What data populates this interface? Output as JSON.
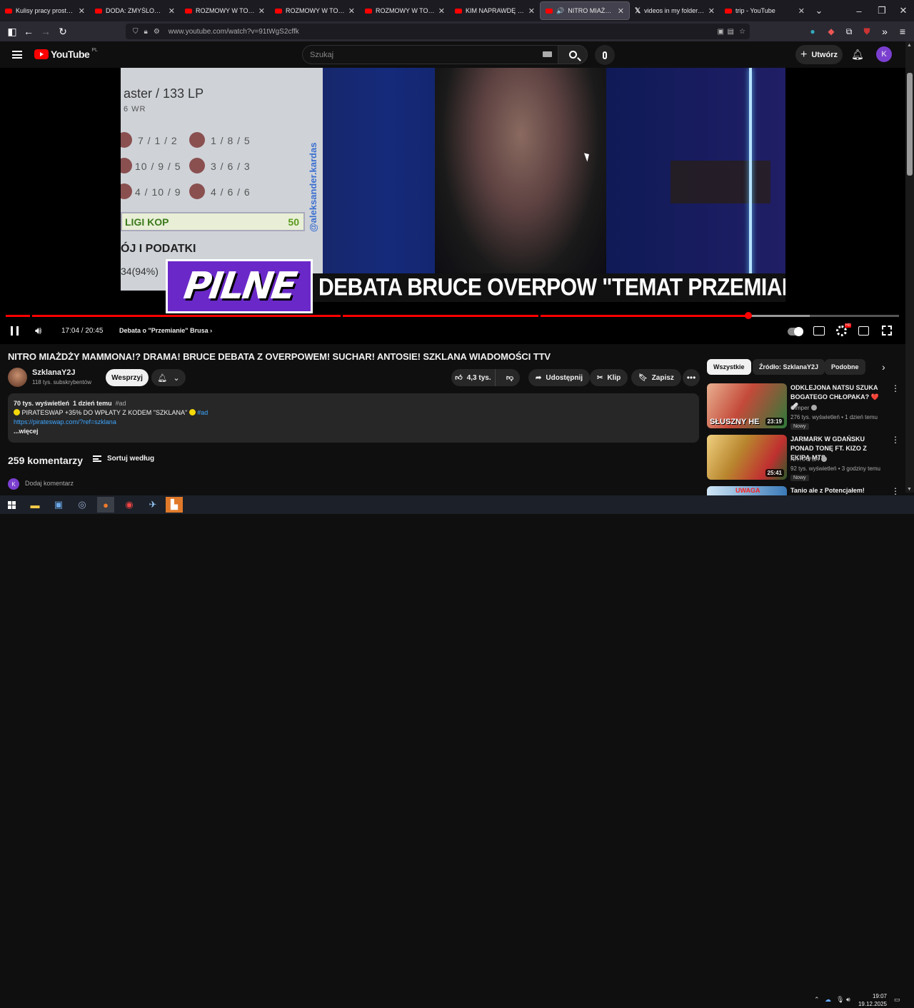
{
  "browser": {
    "tabs": [
      {
        "title": "Kulisy pracy prostytutki. O",
        "icon": "youtube-icon",
        "active": false
      },
      {
        "title": "DODA: ZMYŚLONE ŻYCIE",
        "icon": "youtube-icon",
        "active": false
      },
      {
        "title": "ROZMOWY W TOKU OD",
        "icon": "youtube-icon",
        "active": false
      },
      {
        "title": "ROZMOWY W TOKU OD",
        "icon": "youtube-icon",
        "active": false
      },
      {
        "title": "ROZMOWY W TOKU OD",
        "icon": "youtube-icon",
        "active": false
      },
      {
        "title": "KIM NAPRAWDĘ JEST MA",
        "icon": "youtube-icon",
        "active": false
      },
      {
        "title": "NITRO MIAŻDŻY MA",
        "icon": "youtube-icon",
        "active": true
      },
      {
        "title": "videos in my folder on X",
        "icon": "x-icon",
        "active": false
      },
      {
        "title": "trip - YouTube",
        "icon": "youtube-icon",
        "active": false
      }
    ],
    "url": "www.youtube.com/watch?v=91tWgS2cffk"
  },
  "header": {
    "logo_text": "YouTube",
    "country": "PL",
    "search_placeholder": "Szukaj",
    "create_label": "Utwórz",
    "avatar_letter": "K"
  },
  "player": {
    "overlay": {
      "rank_text": "aster / 133 LP",
      "wr_text": "6 WR",
      "stats": [
        "7 / 1 / 2",
        "1 / 8 / 5",
        "10 / 9 / 5",
        "3 / 6 / 3",
        "4 / 10 / 9",
        "4 / 6 / 6"
      ],
      "league_text": "LIGI KOP",
      "league_value": "50",
      "side_text": "@aleksander.kardas",
      "podatki_text": "ÓJ I PODATKI",
      "percent_text": "34(94%)",
      "badge": "PILNE",
      "ticker": "DEBATA BRUCE OVERPOW \"TEMAT PRZEMIANY OL"
    },
    "progress_played": 0.831,
    "progress_buffered": 0.9,
    "time": "17:04 / 20:45",
    "chapter": "Debata o \"Przemianie\" Brusa"
  },
  "video": {
    "title": "NITRO MIAŻDŻY MAMMONA!? DRAMA! BRUCE DEBATA Z OVERPOWEM! SUCHAR! ANTOSIE! SZKLANA WIADOMOŚCI TTV",
    "channel": "SzklanaY2J",
    "subscribers": "118 tys. subskrybentów",
    "support_label": "Wesprzyj",
    "likes": "4,3 tys.",
    "share_label": "Udostępnij",
    "clip_label": "Klip",
    "save_label": "Zapisz",
    "views": "70 tys. wyświetleń",
    "age": "1 dzień temu",
    "tag": "#ad",
    "desc_line": "PIRATESWAP +35% DO WPŁATY Z KODEM \"SZKLANA\"",
    "desc_tag": "#ad",
    "desc_link": "https://pirateswap.com/?ref=szklana",
    "more_label": "...więcej"
  },
  "comments": {
    "count": "259 komentarzy",
    "sort_label": "Sortuj według",
    "add_placeholder": "Dodaj komentarz",
    "avatar_letter": "K"
  },
  "filters": [
    "Wszystkie",
    "Źródło: SzklanaY2J",
    "Podobne"
  ],
  "recommendations": [
    {
      "title": "ODKLEJONA NATSU SZUKA BOGATEGO CHŁOPAKA? ❤️🩹",
      "channel": "Gimper",
      "meta": "276 tys. wyświetleń • 1 dzień temu",
      "badge": "Nowy",
      "duration": "23:19",
      "thumb_text": "SŁUSZNY HE",
      "color": "#c44a3a"
    },
    {
      "title": "JARMARK W GDAŃSKU PONAD TONĘ FT. KIZO Z EKIPĄ MTS",
      "channel": "NA HAPSA",
      "meta": "92 tys. wyświetleń • 3 godziny temu",
      "badge": "Nowy",
      "duration": "25:41",
      "thumb_text": "",
      "color": "#b8862e"
    },
    {
      "title": "Tanio ale z Potencjałem!",
      "channel": "",
      "meta": "",
      "badge": "",
      "duration": "",
      "thumb_text": "UWAGA",
      "color": "#3a7ab8"
    }
  ],
  "taskbar": {
    "time": "19:07",
    "date": "19.12.2025"
  },
  "colors": {
    "accent": "#ff0000",
    "purple": "#6a28c8",
    "link": "#3ea6ff"
  }
}
